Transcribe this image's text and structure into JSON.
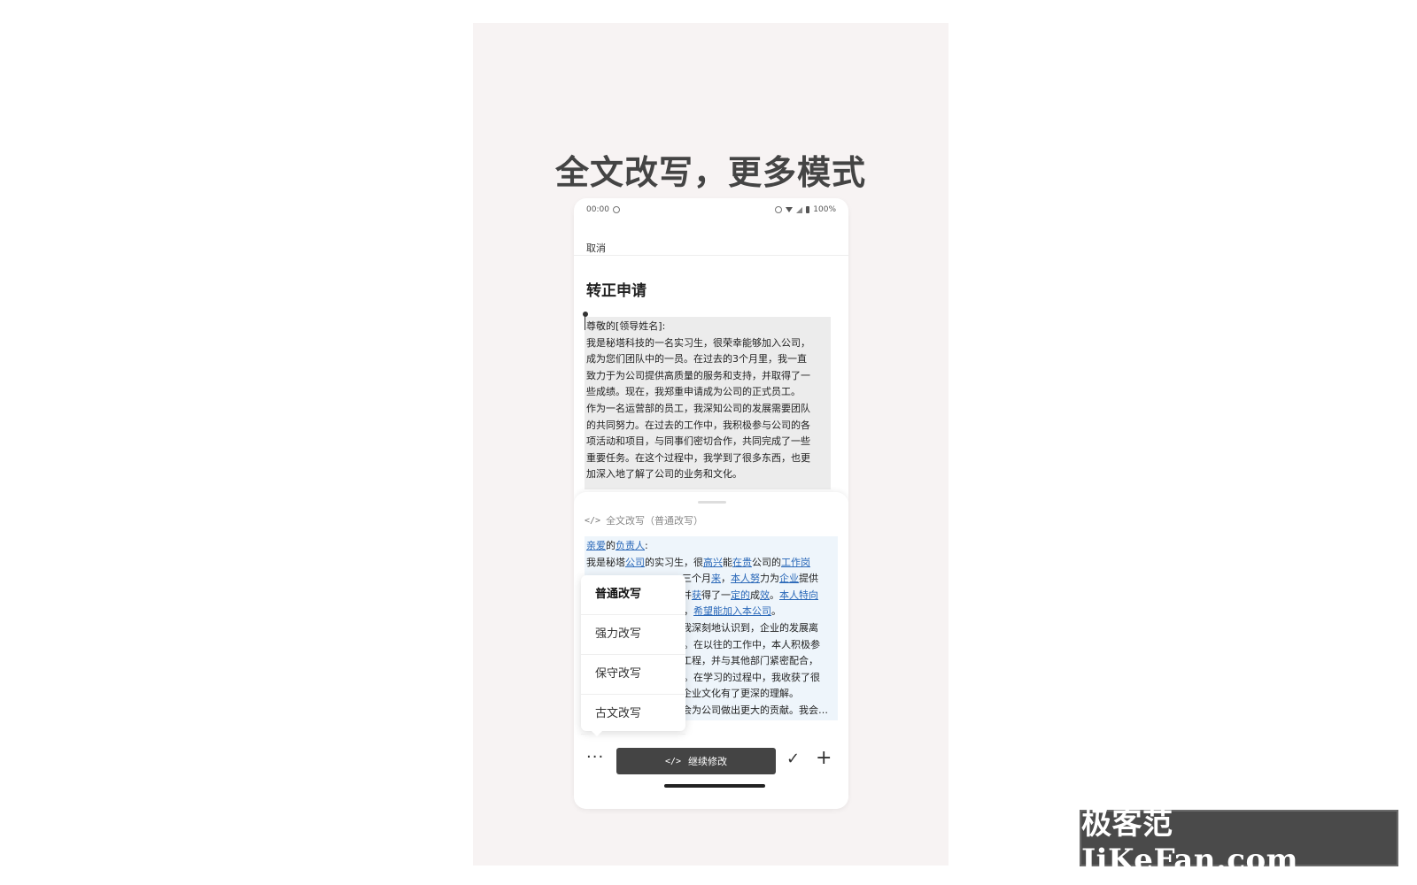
{
  "poster": {
    "headline": "全文改写，更多模式"
  },
  "status_bar": {
    "time": "00:00",
    "battery": "100%"
  },
  "editor": {
    "cancel_label": "取消",
    "doc_title": "转正申请",
    "original_lines": [
      "尊敬的[领导姓名]:",
      "我是秘塔科技的一名实习生，很荣幸能够加入公司，",
      "成为您们团队中的一员。在过去的3个月里，我一直",
      "致力于为公司提供高质量的服务和支持，并取得了一",
      "些成绩。现在，我郑重申请成为公司的正式员工。",
      "作为一名运营部的员工，我深知公司的发展需要团队",
      "的共同努力。在过去的工作中，我积极参与公司的各",
      "项活动和项目，与同事们密切合作，共同完成了一些",
      "重要任务。在这个过程中，我学到了很多东西，也更",
      "加深入地了解了公司的业务和文化。"
    ]
  },
  "sheet": {
    "mode_header": "全文改写（普通改写）",
    "rewrite_line1": {
      "a": "亲爱",
      "b": "的",
      "c": "负责人",
      "d": ":"
    },
    "rewrite_line2": {
      "a": "我是秘塔",
      "b": "公司",
      "c": "的实习生，很",
      "d": "高兴",
      "e": "能",
      "f": "在贵",
      "g": "公司的",
      "h": "工作岗"
    },
    "rewrite_line3": {
      "a": "三个月",
      "b": "来",
      "c": "，",
      "d": "本人努",
      "e": "力为",
      "f": "企业",
      "g": "提供"
    },
    "rewrite_line4": {
      "a": "并",
      "b": "获",
      "c": "得了一",
      "d": "定的",
      "e": "成",
      "f": "效",
      "g": "。",
      "h": "本人特向"
    },
    "rewrite_line5": {
      "a": "，",
      "b": "希望能加入本公司",
      "c": "。"
    },
    "rewrite_line6": "我深刻地认识到，企业的发展离",
    "rewrite_line7": "。在以往的工作中，本人积极参",
    "rewrite_line8": "工程，并与其他部门紧密配合，",
    "rewrite_line9": "。在学习的过程中，我收获了很",
    "rewrite_line10": "企业文化有了更深的理解。",
    "rewrite_line11": "会为公司做出更大的贡献。我会…",
    "menu_items": [
      "普通改写",
      "强力改写",
      "保守改写",
      "古文改写"
    ],
    "more_label": "···",
    "continue_label": "继续修改",
    "check_label": "✓",
    "plus_label": "+"
  },
  "watermark": "极客范 JiKeFan.com",
  "colors": {
    "poster_bg": "#f7f3f3",
    "highlight_link": "#2a68b8",
    "original_bg": "#ececec",
    "rewrite_bg": "#eef5fb",
    "button_dark": "#444444"
  }
}
